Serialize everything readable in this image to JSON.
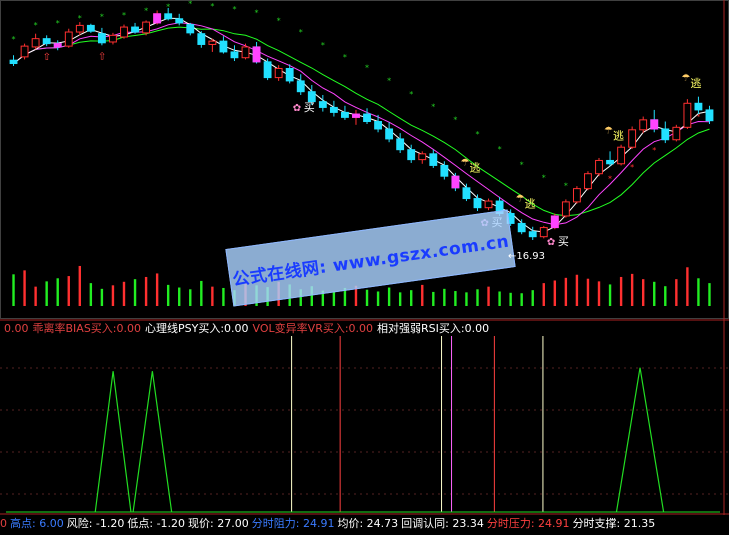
{
  "chart_data": {
    "type": "candlestick",
    "sell_label": "逃",
    "buy_label": "买",
    "low_marker": "←16.93",
    "candles": [
      [
        38.6,
        39.2,
        37.9,
        38.2
      ],
      [
        39.0,
        40.6,
        38.7,
        40.3
      ],
      [
        40.2,
        41.8,
        39.9,
        41.2
      ],
      [
        41.2,
        41.6,
        40.3,
        40.6
      ],
      [
        40.6,
        41.0,
        39.8,
        40.2
      ],
      [
        40.3,
        42.4,
        40.1,
        42.0
      ],
      [
        42.0,
        43.2,
        41.6,
        42.8
      ],
      [
        42.8,
        43.0,
        41.9,
        42.1
      ],
      [
        41.8,
        42.5,
        40.4,
        40.7
      ],
      [
        40.8,
        41.9,
        40.5,
        41.6
      ],
      [
        41.4,
        42.9,
        41.2,
        42.6
      ],
      [
        42.6,
        43.1,
        41.8,
        42.0
      ],
      [
        41.9,
        43.4,
        41.6,
        43.2
      ],
      [
        43.1,
        44.6,
        42.9,
        44.2
      ],
      [
        44.2,
        44.9,
        43.4,
        43.6
      ],
      [
        43.6,
        44.2,
        42.8,
        43.1
      ],
      [
        42.9,
        43.1,
        41.6,
        41.9
      ],
      [
        41.8,
        42.1,
        40.1,
        40.5
      ],
      [
        40.5,
        41.2,
        39.6,
        40.9
      ],
      [
        40.9,
        41.5,
        39.4,
        39.6
      ],
      [
        39.6,
        40.4,
        38.5,
        38.9
      ],
      [
        38.9,
        40.6,
        38.7,
        40.2
      ],
      [
        40.2,
        40.8,
        38.2,
        38.4
      ],
      [
        38.4,
        38.8,
        36.2,
        36.5
      ],
      [
        36.5,
        38.0,
        36.1,
        37.6
      ],
      [
        37.6,
        38.1,
        35.8,
        36.1
      ],
      [
        36.1,
        36.9,
        34.4,
        34.8
      ],
      [
        34.8,
        35.6,
        33.2,
        33.6
      ],
      [
        33.6,
        34.4,
        32.4,
        32.9
      ],
      [
        32.9,
        33.7,
        31.8,
        32.3
      ],
      [
        32.3,
        33.1,
        31.4,
        31.7
      ],
      [
        31.7,
        32.6,
        30.8,
        32.1
      ],
      [
        32.1,
        32.8,
        30.9,
        31.2
      ],
      [
        31.2,
        32.0,
        29.9,
        30.3
      ],
      [
        30.3,
        31.1,
        28.7,
        29.1
      ],
      [
        29.1,
        29.8,
        27.4,
        27.8
      ],
      [
        27.8,
        28.4,
        26.2,
        26.6
      ],
      [
        26.6,
        27.6,
        26.1,
        27.3
      ],
      [
        27.3,
        27.8,
        25.6,
        25.9
      ],
      [
        25.9,
        26.4,
        24.2,
        24.6
      ],
      [
        24.6,
        25.0,
        22.8,
        23.2
      ],
      [
        23.2,
        23.7,
        21.6,
        21.9
      ],
      [
        21.9,
        22.4,
        20.4,
        20.8
      ],
      [
        20.8,
        21.9,
        20.5,
        21.6
      ],
      [
        21.6,
        22.1,
        19.8,
        20.1
      ],
      [
        20.1,
        20.6,
        18.6,
        18.9
      ],
      [
        18.9,
        19.4,
        17.6,
        17.9
      ],
      [
        17.9,
        18.5,
        16.9,
        17.3
      ],
      [
        17.3,
        18.6,
        17.1,
        18.4
      ],
      [
        18.4,
        20.1,
        18.2,
        19.8
      ],
      [
        19.8,
        21.8,
        19.6,
        21.5
      ],
      [
        21.5,
        23.4,
        21.3,
        23.1
      ],
      [
        23.1,
        25.2,
        22.9,
        24.9
      ],
      [
        24.9,
        26.8,
        24.6,
        26.5
      ],
      [
        26.5,
        27.6,
        25.8,
        26.1
      ],
      [
        26.1,
        28.4,
        25.9,
        28.1
      ],
      [
        28.1,
        30.6,
        27.9,
        30.2
      ],
      [
        30.2,
        31.8,
        29.8,
        31.4
      ],
      [
        31.4,
        32.6,
        29.9,
        30.3
      ],
      [
        30.3,
        31.2,
        28.6,
        29.0
      ],
      [
        29.0,
        30.8,
        28.8,
        30.5
      ],
      [
        30.5,
        33.9,
        30.3,
        33.4
      ],
      [
        33.4,
        34.2,
        32.1,
        32.6
      ],
      [
        32.6,
        33.1,
        30.9,
        31.3
      ]
    ],
    "volumes": [
      0.72,
      0.81,
      0.44,
      0.56,
      0.63,
      0.68,
      0.91,
      0.52,
      0.39,
      0.47,
      0.55,
      0.61,
      0.66,
      0.74,
      0.48,
      0.42,
      0.38,
      0.57,
      0.44,
      0.41,
      0.36,
      0.58,
      0.47,
      0.43,
      0.55,
      0.49,
      0.38,
      0.45,
      0.35,
      0.33,
      0.41,
      0.46,
      0.37,
      0.33,
      0.42,
      0.31,
      0.36,
      0.48,
      0.32,
      0.39,
      0.34,
      0.31,
      0.38,
      0.44,
      0.33,
      0.3,
      0.29,
      0.36,
      0.52,
      0.58,
      0.64,
      0.71,
      0.62,
      0.56,
      0.49,
      0.66,
      0.73,
      0.61,
      0.55,
      0.45,
      0.61,
      0.88,
      0.63,
      0.52
    ],
    "sell_signals": [
      14,
      41,
      46,
      54,
      61
    ],
    "buy_signals": [
      26,
      43,
      49
    ],
    "trend_markers_index": [
      3,
      8
    ],
    "indicator_title": [
      {
        "text": "0.00",
        "color": "#e04040"
      },
      {
        "text": "乖离率BIAS买入:0.00",
        "color": "#e04040"
      },
      {
        "text": "心理线PSY买入:0.00",
        "color": "#ffffff"
      },
      {
        "text": "VOL变异率VR买入:0.00",
        "color": "#e04040"
      },
      {
        "text": "相对强弱RSI买入:0.00",
        "color": "#ffffff"
      }
    ],
    "indicator_peaks": [
      {
        "start": 0.125,
        "peak": 0.15,
        "end": 0.175,
        "level": 0.8,
        "color": "#22dd22"
      },
      {
        "start": 0.178,
        "peak": 0.205,
        "end": 0.232,
        "level": 0.8,
        "color": "#22dd22"
      },
      {
        "start": 0.855,
        "peak": 0.888,
        "end": 0.921,
        "level": 0.82,
        "color": "#22dd22"
      }
    ],
    "indicator_vlines": [
      {
        "pos": 0.4,
        "color": "#ffffcc"
      },
      {
        "pos": 0.468,
        "color": "#ff4040"
      },
      {
        "pos": 0.61,
        "color": "#ffffcc"
      },
      {
        "pos": 0.624,
        "color": "#ff66ff"
      },
      {
        "pos": 0.684,
        "color": "#ff4040"
      },
      {
        "pos": 0.752,
        "color": "#ffffcc"
      }
    ],
    "status_items": [
      {
        "text": "0",
        "color": "#e04040"
      },
      {
        "text": "高点: 6.00",
        "color": "#3a7bff"
      },
      {
        "text": "风险: -1.20",
        "color": "#ffffff"
      },
      {
        "text": "低点: -1.20",
        "color": "#ffffff"
      },
      {
        "text": "现价: 27.00",
        "color": "#ffffff"
      },
      {
        "text": "分时阻力: 24.91",
        "color": "#3a7bff"
      },
      {
        "text": "均价: 24.73",
        "color": "#ffffff"
      },
      {
        "text": "回调认同: 23.34",
        "color": "#ffffff"
      },
      {
        "text": "分时压力: 24.91",
        "color": "#ff4040"
      },
      {
        "text": "分时支撑: 21.35",
        "color": "#ffffff"
      }
    ],
    "watermark": "公式在线网: www.gszx.com.cn",
    "colors": {
      "up": "#ff3030",
      "down": "#22e0ff",
      "ma1": "#ffffff",
      "ma2": "#ff44ff",
      "ma3": "#22ff22",
      "dot": "#22cc22",
      "dot_red": "#ff3030"
    }
  }
}
